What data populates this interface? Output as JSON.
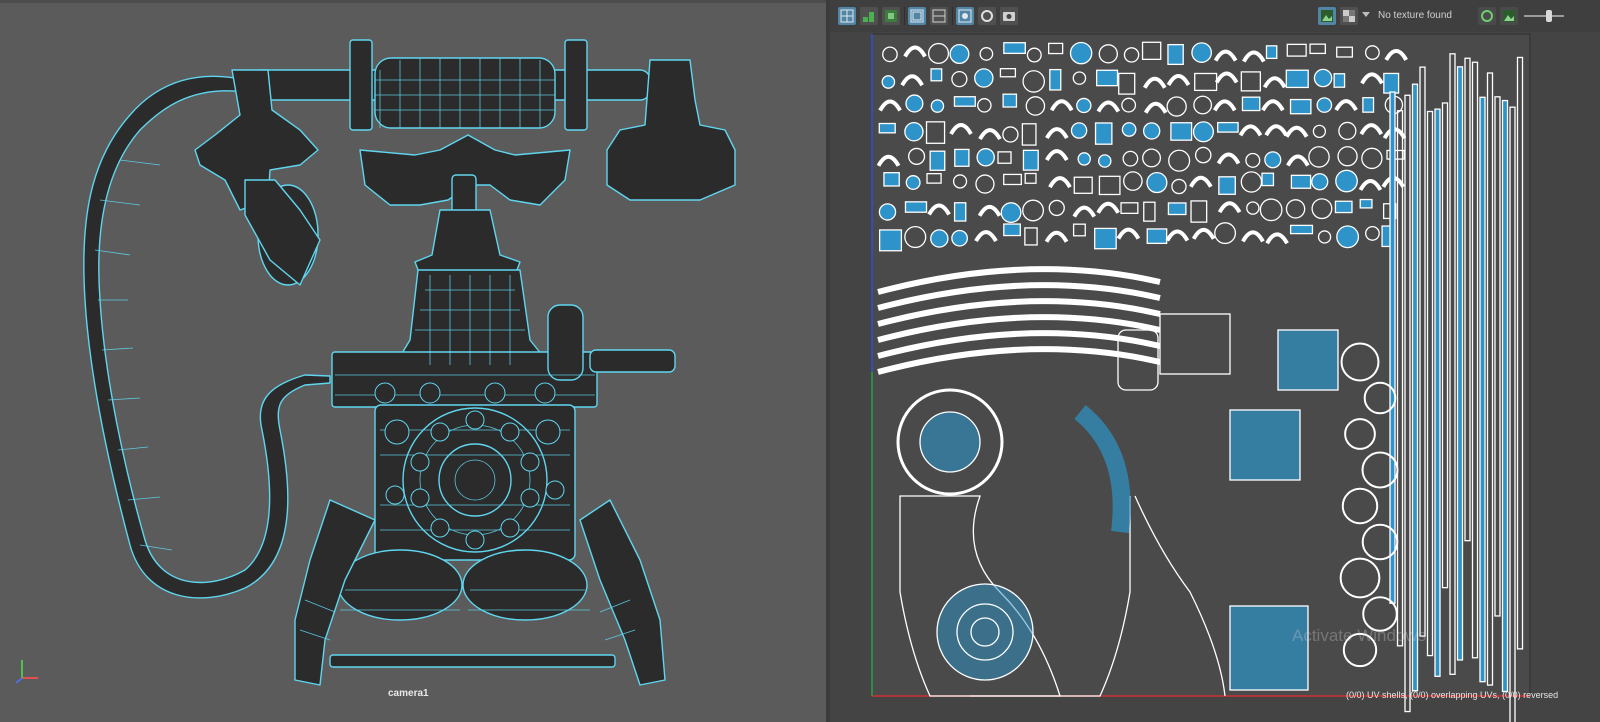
{
  "viewport": {
    "camera_label": "camera1",
    "wire_color": "#5fd6ef",
    "background": "#5b5b5b"
  },
  "uv_editor": {
    "toolbar": {
      "texture_status": "No texture found",
      "buttons": [
        {
          "name": "uv-grid-icon",
          "active": true
        },
        {
          "name": "shaded-uv-icon",
          "active": false
        },
        {
          "name": "distortion-icon",
          "active": false
        },
        {
          "name": "display-image-icon",
          "active": true
        },
        {
          "name": "checker-icon",
          "active": false
        },
        {
          "name": "uv-border-icon",
          "active": true
        },
        {
          "name": "textured-mode-icon",
          "active": false
        },
        {
          "name": "snapshot-icon",
          "active": false
        }
      ]
    },
    "status_line": "(0/0) UV shells, (0/0) overlapping UVs, (0/0) reversed",
    "watermark": "Activate Windows",
    "shell_color": "#ffffff",
    "shell_fill": "#2e93c8"
  }
}
